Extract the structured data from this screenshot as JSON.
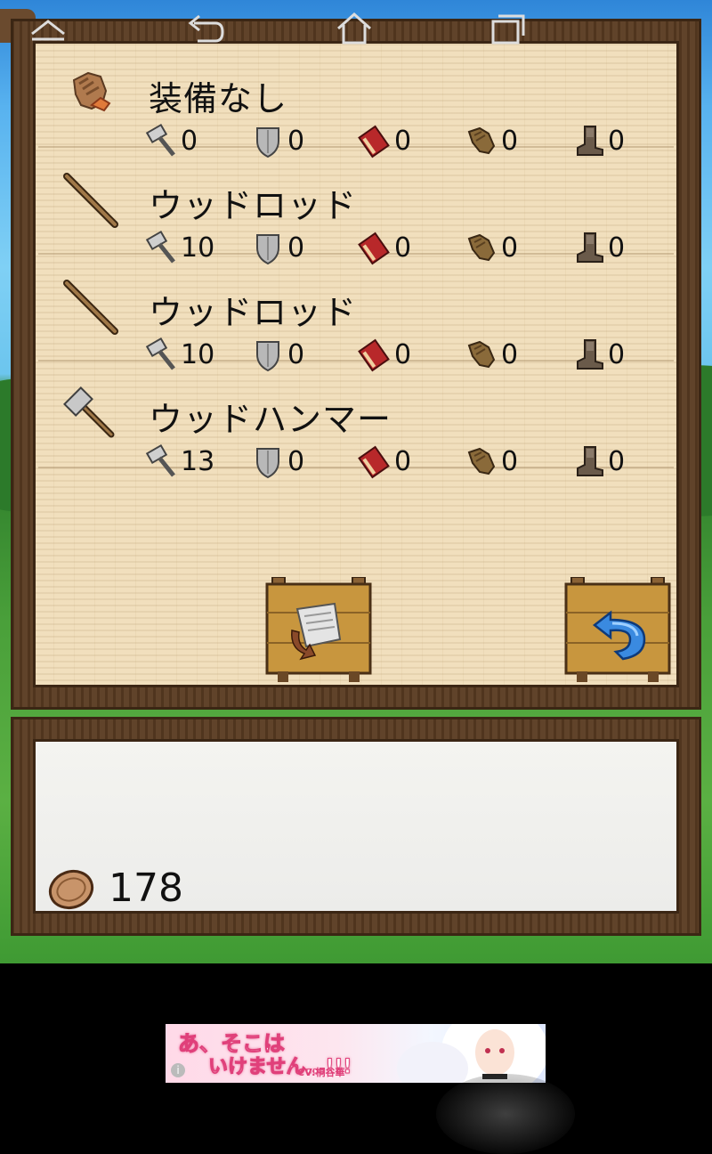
{
  "equipment": [
    {
      "name": "装備なし",
      "icon": "glove-icon",
      "attack": "0",
      "defense": "0",
      "magic": "0",
      "gloves": "0",
      "boots": "0"
    },
    {
      "name": "ウッドロッド",
      "icon": "wood-rod-icon",
      "attack": "10",
      "defense": "0",
      "magic": "0",
      "gloves": "0",
      "boots": "0"
    },
    {
      "name": "ウッドロッド",
      "icon": "wood-rod-icon",
      "attack": "10",
      "defense": "0",
      "magic": "0",
      "gloves": "0",
      "boots": "0"
    },
    {
      "name": "ウッドハンマー",
      "icon": "hammer-icon",
      "attack": "13",
      "defense": "0",
      "magic": "0",
      "gloves": "0",
      "boots": "0"
    }
  ],
  "buttons": {
    "recycle": "scroll-recycle-icon",
    "back": "return-arrow-icon"
  },
  "wallet": {
    "coins": "178",
    "icon": "coin-icon"
  },
  "ad": {
    "line1": "あ、そこは",
    "line2": "いけません…!!!",
    "cv": "CV:桐谷華"
  },
  "colors": {
    "wood_frame": "#5a3c22",
    "parchment": "#f1dfbd",
    "text": "#111111",
    "ad_pink": "#e0407a"
  }
}
